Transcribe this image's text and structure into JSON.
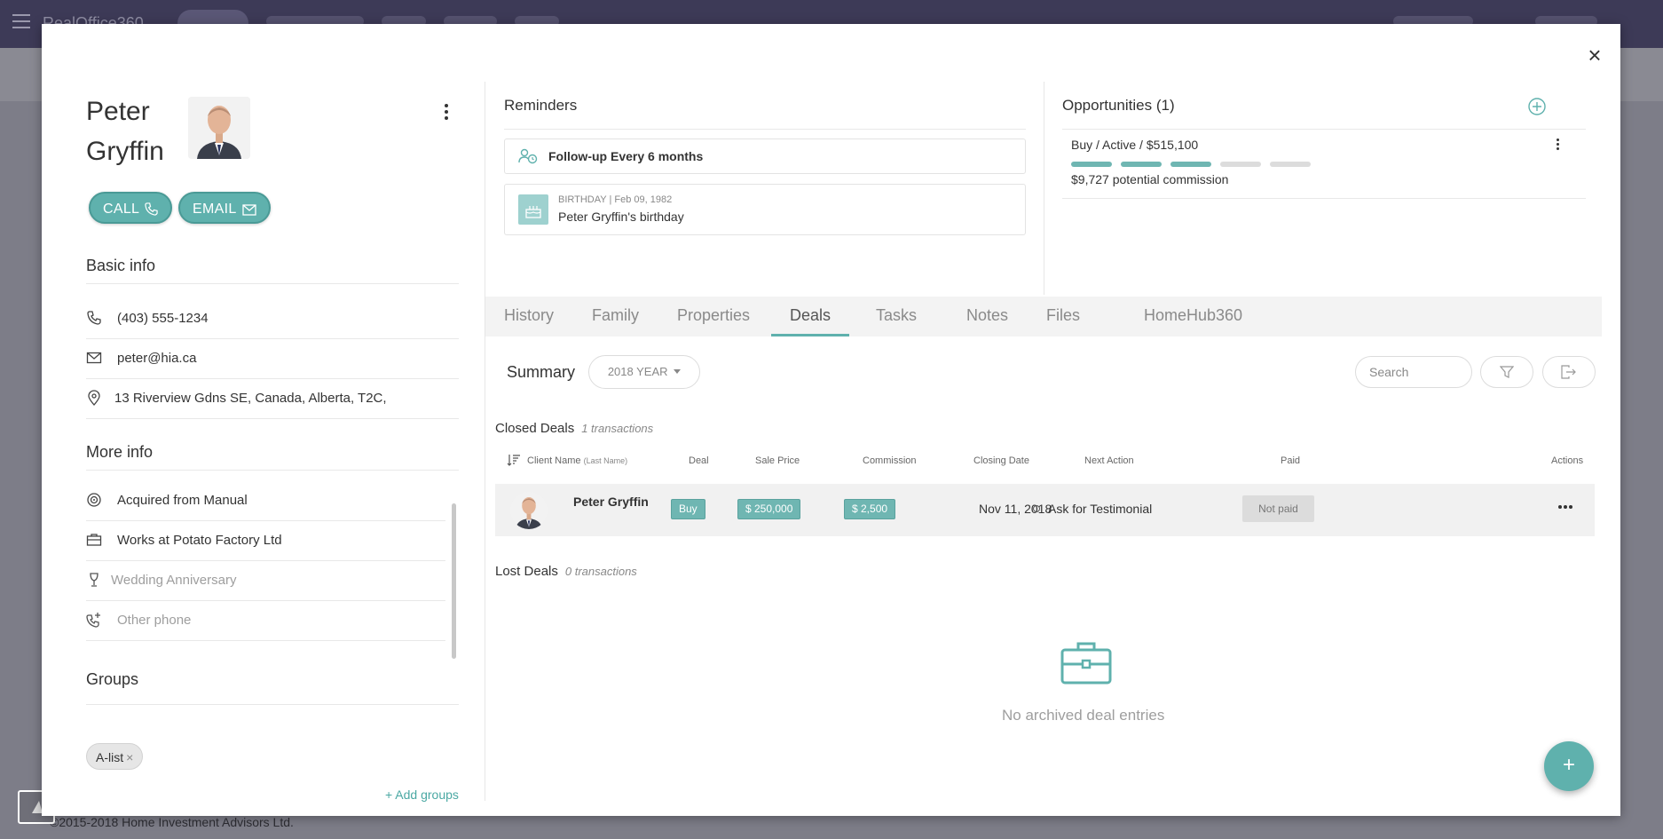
{
  "background": {
    "brand": "RealOffice360",
    "footer": "©2015-2018 Home Investment Advisors Ltd."
  },
  "contact": {
    "first_name": "Peter",
    "last_name": "Gryffin",
    "call_label": "CALL",
    "email_label": "EMAIL"
  },
  "basic_info": {
    "title": "Basic info",
    "phone": "(403) 555-1234",
    "email": "peter@hia.ca",
    "address": "13 Riverview Gdns SE, Canada, Alberta, T2C,"
  },
  "more_info": {
    "title": "More info",
    "items": [
      {
        "icon": "target-icon",
        "text": "Acquired from Manual",
        "muted": false
      },
      {
        "icon": "briefcase-icon",
        "text": "Works at Potato Factory Ltd",
        "muted": false
      },
      {
        "icon": "glass-icon",
        "text": "Wedding Anniversary",
        "muted": true
      },
      {
        "icon": "phone-plus-icon",
        "text": "Other phone",
        "muted": true
      }
    ]
  },
  "groups": {
    "title": "Groups",
    "chips": [
      "A-list"
    ],
    "add_label": "+ Add groups"
  },
  "reminders": {
    "title": "Reminders",
    "followup": "Follow-up Every 6 months",
    "birthday_meta": "BIRTHDAY | Feb 09, 1982",
    "birthday_text": "Peter Gryffin's birthday"
  },
  "opportunities": {
    "title": "Opportunities (1)",
    "item": "Buy / Active / $515,100",
    "stages_complete": 3,
    "stages_total": 5,
    "commission": "$9,727 potential commission"
  },
  "tabs": [
    "History",
    "Family",
    "Properties",
    "Deals",
    "Tasks",
    "Notes",
    "Files",
    "HomeHub360"
  ],
  "active_tab": "Deals",
  "deals": {
    "summary_label": "Summary",
    "year_label": "2018 YEAR",
    "search_placeholder": "Search",
    "closed_title": "Closed Deals",
    "closed_count": "1 transactions",
    "lost_title": "Lost Deals",
    "lost_count": "0 transactions",
    "columns": {
      "client": "Client Name",
      "client_sub": "(Last Name)",
      "deal": "Deal",
      "sale_price": "Sale Price",
      "commission": "Commission",
      "closing_date": "Closing Date",
      "next_action": "Next Action",
      "paid": "Paid",
      "actions": "Actions"
    },
    "rows": [
      {
        "client": "Peter Gryffin",
        "deal": "Buy",
        "sale_price": "$ 250,000",
        "commission": "$ 2,500",
        "closing_date": "Nov 11, 2018",
        "next_action": "Ask for Testimonial",
        "paid": "Not paid"
      }
    ],
    "empty_text": "No archived deal entries"
  },
  "colors": {
    "accent": "#5fb1ad",
    "topbar": "#3d3a57"
  }
}
